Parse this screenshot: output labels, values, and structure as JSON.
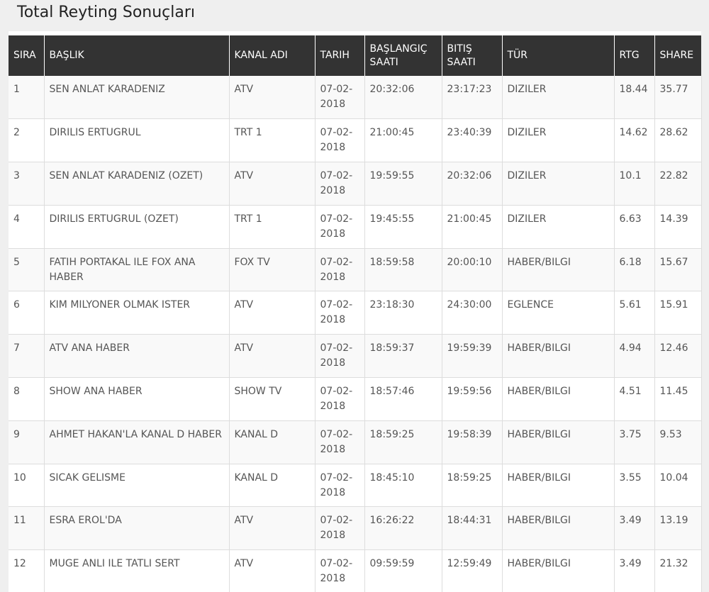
{
  "page": {
    "title": "Total Reyting Sonuçları"
  },
  "table": {
    "headers": {
      "sira": "SIRA",
      "baslik": "BAŞLIK",
      "kanal": "KANAL ADI",
      "tarih": "TARIH",
      "baslangic": "BAŞLANGIÇ SAATI",
      "bitis": "BITIŞ SAATI",
      "tur": "TÜR",
      "rtg": "RTG",
      "share": "SHARE"
    },
    "rows": [
      {
        "sira": "1",
        "baslik": "SEN ANLAT KARADENIZ",
        "kanal": "ATV",
        "tarih": "07-02-2018",
        "baslangic": "20:32:06",
        "bitis": "23:17:23",
        "tur": "DIZILER",
        "rtg": "18.44",
        "share": "35.77"
      },
      {
        "sira": "2",
        "baslik": "DIRILIS ERTUGRUL",
        "kanal": "TRT 1",
        "tarih": "07-02-2018",
        "baslangic": "21:00:45",
        "bitis": "23:40:39",
        "tur": "DIZILER",
        "rtg": "14.62",
        "share": "28.62"
      },
      {
        "sira": "3",
        "baslik": "SEN ANLAT KARADENIZ (OZET)",
        "kanal": "ATV",
        "tarih": "07-02-2018",
        "baslangic": "19:59:55",
        "bitis": "20:32:06",
        "tur": "DIZILER",
        "rtg": "10.1",
        "share": "22.82"
      },
      {
        "sira": "4",
        "baslik": "DIRILIS ERTUGRUL (OZET)",
        "kanal": "TRT 1",
        "tarih": "07-02-2018",
        "baslangic": "19:45:55",
        "bitis": "21:00:45",
        "tur": "DIZILER",
        "rtg": "6.63",
        "share": "14.39"
      },
      {
        "sira": "5",
        "baslik": "FATIH PORTAKAL ILE FOX ANA HABER",
        "kanal": "FOX TV",
        "tarih": "07-02-2018",
        "baslangic": "18:59:58",
        "bitis": "20:00:10",
        "tur": "HABER/BILGI",
        "rtg": "6.18",
        "share": "15.67"
      },
      {
        "sira": "6",
        "baslik": "KIM MILYONER OLMAK ISTER",
        "kanal": "ATV",
        "tarih": "07-02-2018",
        "baslangic": "23:18:30",
        "bitis": "24:30:00",
        "tur": "EGLENCE",
        "rtg": "5.61",
        "share": "15.91"
      },
      {
        "sira": "7",
        "baslik": "ATV ANA HABER",
        "kanal": "ATV",
        "tarih": "07-02-2018",
        "baslangic": "18:59:37",
        "bitis": "19:59:39",
        "tur": "HABER/BILGI",
        "rtg": "4.94",
        "share": "12.46"
      },
      {
        "sira": "8",
        "baslik": "SHOW ANA HABER",
        "kanal": "SHOW TV",
        "tarih": "07-02-2018",
        "baslangic": "18:57:46",
        "bitis": "19:59:56",
        "tur": "HABER/BILGI",
        "rtg": "4.51",
        "share": "11.45"
      },
      {
        "sira": "9",
        "baslik": "AHMET HAKAN'LA KANAL D HABER",
        "kanal": "KANAL D",
        "tarih": "07-02-2018",
        "baslangic": "18:59:25",
        "bitis": "19:58:39",
        "tur": "HABER/BILGI",
        "rtg": "3.75",
        "share": "9.53"
      },
      {
        "sira": "10",
        "baslik": "SICAK GELISME",
        "kanal": "KANAL D",
        "tarih": "07-02-2018",
        "baslangic": "18:45:10",
        "bitis": "18:59:25",
        "tur": "HABER/BILGI",
        "rtg": "3.55",
        "share": "10.04"
      },
      {
        "sira": "11",
        "baslik": "ESRA EROL'DA",
        "kanal": "ATV",
        "tarih": "07-02-2018",
        "baslangic": "16:26:22",
        "bitis": "18:44:31",
        "tur": "HABER/BILGI",
        "rtg": "3.49",
        "share": "13.19"
      },
      {
        "sira": "12",
        "baslik": "MUGE ANLI ILE TATLI SERT",
        "kanal": "ATV",
        "tarih": "07-02-2018",
        "baslangic": "09:59:59",
        "bitis": "12:59:49",
        "tur": "HABER/BILGI",
        "rtg": "3.49",
        "share": "21.32"
      }
    ]
  }
}
